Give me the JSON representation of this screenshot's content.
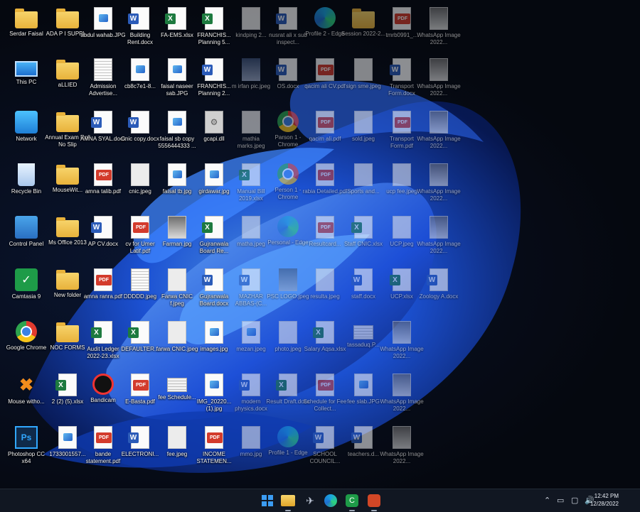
{
  "desktop": {
    "columns": [
      [
        {
          "label": "Serdar Faisal",
          "type": "folder"
        },
        {
          "label": "This PC",
          "type": "pc"
        },
        {
          "label": "Network",
          "type": "network"
        },
        {
          "label": "Recycle Bin",
          "type": "recycle"
        },
        {
          "label": "Control Panel",
          "type": "cpanel"
        },
        {
          "label": "Camtasia 9",
          "type": "camtasia"
        },
        {
          "label": "Google Chrome",
          "type": "chrome"
        },
        {
          "label": "Mouse witho...",
          "type": "mouse"
        },
        {
          "label": "Photoshop CC x64",
          "type": "ps"
        }
      ],
      [
        {
          "label": "ADA P I SUPPI...",
          "type": "folder"
        },
        {
          "label": "aLLIED",
          "type": "folder"
        },
        {
          "label": "Annual Exam Roll No Slip",
          "type": "folder"
        },
        {
          "label": "MouseWit...",
          "type": "folder"
        },
        {
          "label": "Ms Office 2013",
          "type": "folder"
        },
        {
          "label": "New folder",
          "type": "folder"
        },
        {
          "label": "NOC FORMS",
          "type": "folder"
        },
        {
          "label": "2 (2) (5).xlsx",
          "type": "excel"
        },
        {
          "label": "1733001557...",
          "type": "image"
        }
      ],
      [
        {
          "label": "abdul wahab.JPG",
          "type": "image"
        },
        {
          "label": "Admission Advertise...",
          "type": "scandoc"
        },
        {
          "label": "AMNA SYAL.docx",
          "type": "word"
        },
        {
          "label": "amna talib.pdf",
          "type": "pdf"
        },
        {
          "label": "AP CV.docx",
          "type": "word"
        },
        {
          "label": "amna ranra.pdf",
          "type": "pdf"
        },
        {
          "label": "Audit Ledger 2022-23.xlsx",
          "type": "excel"
        },
        {
          "label": "Bandicam",
          "type": "bandicam"
        },
        {
          "label": "bande statement.pdf",
          "type": "pdf"
        }
      ],
      [
        {
          "label": "Building Rent.docx",
          "type": "word"
        },
        {
          "label": "cb8c7e1-8...",
          "type": "image"
        },
        {
          "label": "Cnic copy.docx",
          "type": "word"
        },
        {
          "label": "cnic.jpeg",
          "type": "file"
        },
        {
          "label": "cv for Umer Latif.pdf",
          "type": "pdf"
        },
        {
          "label": "DDDDD.jpeg",
          "type": "scandoc"
        },
        {
          "label": "DEFAULTER...",
          "type": "excel"
        },
        {
          "label": "E-Basta.pdf",
          "type": "pdf"
        },
        {
          "label": "ELECTRONI...",
          "type": "word"
        }
      ],
      [
        {
          "label": "FA-EMS.xlsx",
          "type": "excel"
        },
        {
          "label": "faisal naseer sab.JPG",
          "type": "image"
        },
        {
          "label": "faisal sb copy 5556444333 ...",
          "type": "image"
        },
        {
          "label": "faisal tb.jpg",
          "type": "image"
        },
        {
          "label": "Farman.jpg",
          "type": "photo"
        },
        {
          "label": "Farwa CNIC f.jpeg",
          "type": "file"
        },
        {
          "label": "farwa CNIC.jpeg",
          "type": "file"
        },
        {
          "label": "fee Schedule...",
          "type": "scan"
        },
        {
          "label": "fee.jpeg",
          "type": "file"
        }
      ],
      [
        {
          "label": "FRANCHIS... Planning 5...",
          "type": "excel"
        },
        {
          "label": "FRANCHIS... Planning 2...",
          "type": "word"
        },
        {
          "label": "gcapi.dll",
          "type": "dll"
        },
        {
          "label": "girdawar.jpg",
          "type": "image"
        },
        {
          "label": "Gujranwala Board Re...",
          "type": "excel"
        },
        {
          "label": "Gujranwala Board.docx",
          "type": "word"
        },
        {
          "label": "images.jpg",
          "type": "image"
        },
        {
          "label": "IMG_20220... (1).jpg",
          "type": "image"
        },
        {
          "label": "INCOME STATEMEN...",
          "type": "pdf"
        }
      ],
      [
        {
          "label": "kindping 2...",
          "type": "file"
        },
        {
          "label": "m irfan pic.jpeg",
          "type": "avatar"
        },
        {
          "label": "mathia marks.jpeg",
          "type": "file"
        },
        {
          "label": "Manual Bill 2019.xlsx",
          "type": "excel"
        },
        {
          "label": "matha.jpeg",
          "type": "file"
        },
        {
          "label": "MAZHAR ABBAS-(C...",
          "type": "word"
        },
        {
          "label": "mezan.jpeg",
          "type": "image"
        },
        {
          "label": "modern physics.docx",
          "type": "word"
        },
        {
          "label": "mmo.jpg",
          "type": "file"
        }
      ],
      [
        {
          "label": "nusrat ali x sub inspect...",
          "type": "word"
        },
        {
          "label": "OS.docx",
          "type": "word"
        },
        {
          "label": "Parson 1 - Chrome",
          "type": "chrome"
        },
        {
          "label": "Person 1 - Chrome",
          "type": "chrome"
        },
        {
          "label": "Personal - Edge",
          "type": "edge"
        },
        {
          "label": "PSC LOGO.jpeg",
          "type": "avatar"
        },
        {
          "label": "photo.jpeg",
          "type": "file"
        },
        {
          "label": "Result Draft.docx",
          "type": "excel"
        },
        {
          "label": "Profile 1 - Edge",
          "type": "edge"
        }
      ],
      [
        {
          "label": "Profile 2 - Edge",
          "type": "edge"
        },
        {
          "label": "qacim ali CV.pdf",
          "type": "pdf"
        },
        {
          "label": "qacim ali.pdf",
          "type": "pdf"
        },
        {
          "label": "rabia Detailed.pdf",
          "type": "pdf"
        },
        {
          "label": "Resultcard...",
          "type": "pdf"
        },
        {
          "label": "resulta.jpeg",
          "type": "file"
        },
        {
          "label": "Salary Aqsa.xlsx",
          "type": "excel"
        },
        {
          "label": "Schedule for Fee Collect...",
          "type": "pdf"
        },
        {
          "label": "SCHOOL COUNCIL...",
          "type": "word"
        }
      ],
      [
        {
          "label": "Session 2022-2...",
          "type": "folder"
        },
        {
          "label": "sign sme.jpeg",
          "type": "file"
        },
        {
          "label": "sold.jpeg",
          "type": "file"
        },
        {
          "label": "Sports and...",
          "type": "file"
        },
        {
          "label": "Staff CNIC.xlsx",
          "type": "excel"
        },
        {
          "label": "staff.docx",
          "type": "word"
        },
        {
          "label": "tassaduq.P...",
          "type": "scan"
        },
        {
          "label": "fee slab.JPG",
          "type": "image"
        },
        {
          "label": "teachers.d...",
          "type": "word"
        }
      ],
      [
        {
          "label": "tmrb0991_...",
          "type": "pdf"
        },
        {
          "label": "Transport Form.docx",
          "type": "word"
        },
        {
          "label": "Transport Form.pdf",
          "type": "pdf"
        },
        {
          "label": "ucp fee.jpeg",
          "type": "file"
        },
        {
          "label": "UCP.jpeg",
          "type": "file"
        },
        {
          "label": "UCP.xlsx",
          "type": "excel"
        },
        {
          "label": "WhatsApp Image 2022...",
          "type": "photo"
        },
        {
          "label": "WhatsApp Image 2022...",
          "type": "photo"
        },
        {
          "label": "WhatsApp Image 2022...",
          "type": "photo"
        }
      ],
      [
        {
          "label": "WhatsApp Image 2022...",
          "type": "photo"
        },
        {
          "label": "WhatsApp Image 2022...",
          "type": "photo"
        },
        {
          "label": "WhatsApp Image 2022...",
          "type": "photo"
        },
        {
          "label": "WhatsApp Image 2022...",
          "type": "photo"
        },
        {
          "label": "WhatsApp Image 2022...",
          "type": "photo"
        },
        {
          "label": "Zoology A.docx",
          "type": "word"
        }
      ]
    ]
  },
  "taskbar": {
    "apps": [
      "start-icon",
      "file-explorer-icon",
      "rocket-icon",
      "edge-icon",
      "camtasia-icon",
      "office-icon"
    ],
    "tray_icons": [
      "chevron-up-icon",
      "network-icon",
      "display-icon",
      "volume-icon"
    ],
    "time": "12:42 PM",
    "date": "12/28/2022"
  },
  "colors": {
    "accent": "#3b9cf2",
    "wallpaper_dark": "#05080f",
    "bloom_blue": "#1f5cf0"
  }
}
